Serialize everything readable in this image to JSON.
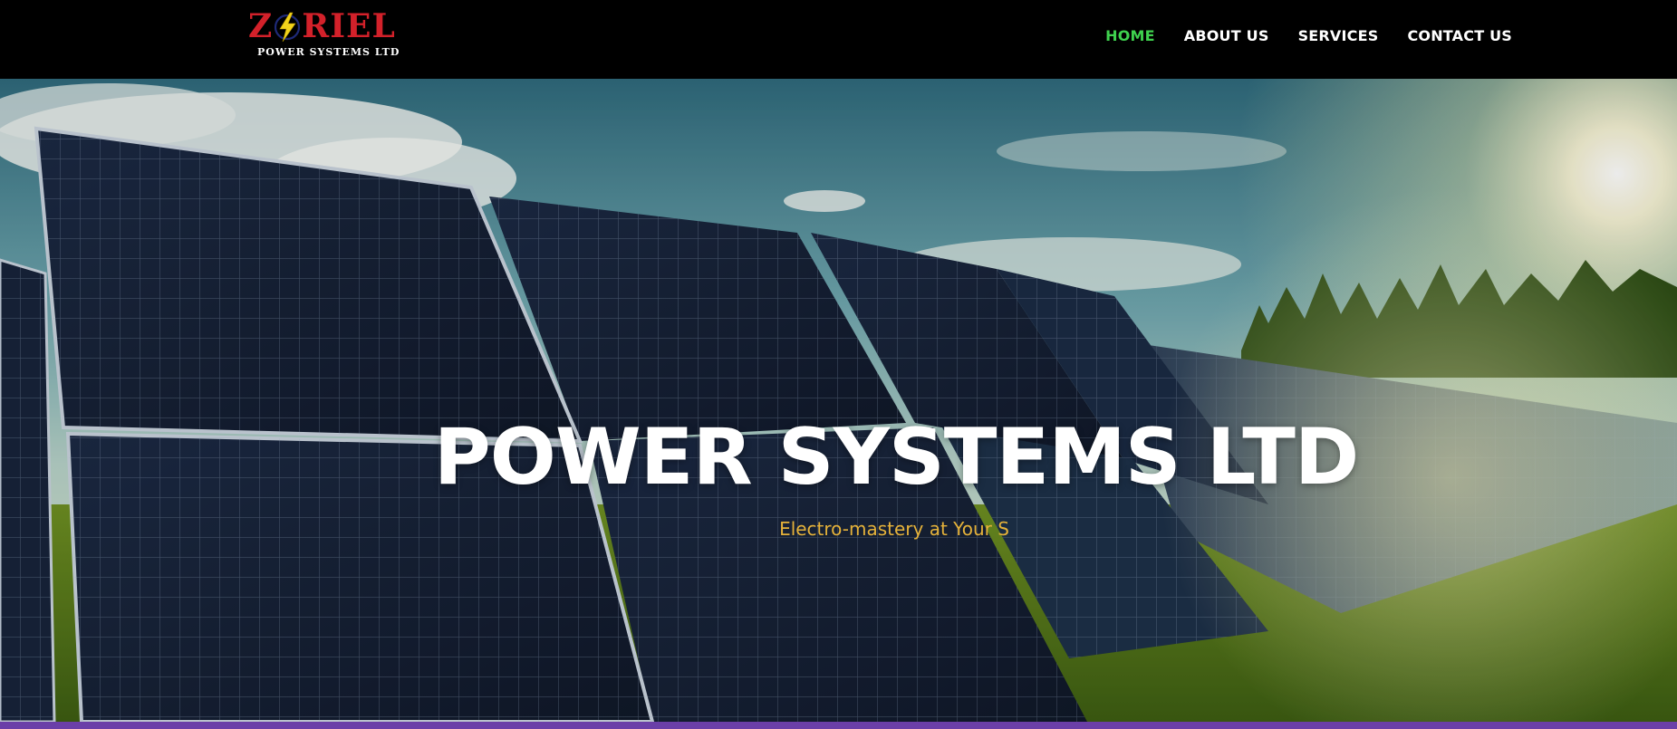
{
  "brand": {
    "name_left": "Z",
    "name_right": "RIEL",
    "tagline": "POWER SYSTEMS LTD",
    "name_color": "#d3212a",
    "bolt_color": "#f2d31b"
  },
  "nav": {
    "items": [
      {
        "label": "HOME",
        "active": true
      },
      {
        "label": "ABOUT US",
        "active": false
      },
      {
        "label": "SERVICES",
        "active": false
      },
      {
        "label": "CONTACT US",
        "active": false
      }
    ],
    "active_color": "#3fd14e",
    "link_color": "#ffffff"
  },
  "hero": {
    "title": "POWER SYSTEMS LTD",
    "subtitle": "Electro-mastery at Your S",
    "subtitle_color": "#e5b23a",
    "background": "solar-panel-field-sunny-sky"
  },
  "accent_strip_color": "#6b3fa8"
}
